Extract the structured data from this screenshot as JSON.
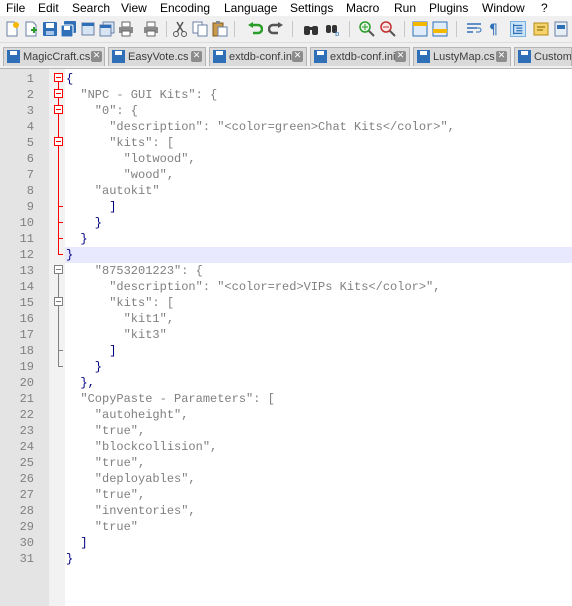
{
  "menu": [
    "File",
    "Edit",
    "Search",
    "View",
    "Encoding",
    "Language",
    "Settings",
    "Macro",
    "Run",
    "Plugins",
    "Window",
    "?"
  ],
  "toolbar": {
    "icons": [
      "new-file-icon",
      "open-file-icon",
      "save-icon",
      "save-all-icon",
      "close-icon",
      "close-all-icon",
      "print-icon",
      "cut-icon",
      "copy-icon",
      "paste-icon",
      "undo-icon",
      "redo-icon",
      "find-icon",
      "replace-icon",
      "zoom-in-icon",
      "zoom-out-icon",
      "sync-vertical-icon",
      "sync-horizontal-icon",
      "word-wrap-icon",
      "show-all-characters-icon",
      "indent-guide-icon",
      "user-defined-language-icon"
    ]
  },
  "tabs": [
    {
      "label": "MagicCraft.cs",
      "active": false
    },
    {
      "label": "EasyVote.cs",
      "active": false
    },
    {
      "label": "extdb-conf.ini",
      "active": false
    },
    {
      "label": "extdb-conf.ini",
      "active": false
    },
    {
      "label": "LustyMap.cs",
      "active": false
    },
    {
      "label": "CustomD",
      "active": false
    }
  ],
  "editor": {
    "current_line": 12,
    "lines": [
      {
        "n": "1",
        "text": "{"
      },
      {
        "n": "2",
        "text": "  \"NPC - GUI Kits\": {"
      },
      {
        "n": "3",
        "text": "    \"0\": {"
      },
      {
        "n": "4",
        "text": "      \"description\": \"<color=green>Chat Kits</color>\","
      },
      {
        "n": "5",
        "text": "      \"kits\": ["
      },
      {
        "n": "6",
        "text": "        \"lotwood\","
      },
      {
        "n": "7",
        "text": "        \"wood\","
      },
      {
        "n": "8",
        "text": "    \"autokit\""
      },
      {
        "n": "9",
        "text": "      ]"
      },
      {
        "n": "10",
        "text": "    }"
      },
      {
        "n": "11",
        "text": "  }"
      },
      {
        "n": "12",
        "text": "}"
      },
      {
        "n": "13",
        "text": "    \"8753201223\": {"
      },
      {
        "n": "14",
        "text": "      \"description\": \"<color=red>VIPs Kits</color>\","
      },
      {
        "n": "15",
        "text": "      \"kits\": ["
      },
      {
        "n": "16",
        "text": "        \"kit1\","
      },
      {
        "n": "17",
        "text": "        \"kit3\""
      },
      {
        "n": "18",
        "text": "      ]"
      },
      {
        "n": "19",
        "text": "    }"
      },
      {
        "n": "20",
        "text": "  },"
      },
      {
        "n": "21",
        "text": "  \"CopyPaste - Parameters\": ["
      },
      {
        "n": "22",
        "text": "    \"autoheight\","
      },
      {
        "n": "23",
        "text": "    \"true\","
      },
      {
        "n": "24",
        "text": "    \"blockcollision\","
      },
      {
        "n": "25",
        "text": "    \"true\","
      },
      {
        "n": "26",
        "text": "    \"deployables\","
      },
      {
        "n": "27",
        "text": "    \"true\","
      },
      {
        "n": "28",
        "text": "    \"inventories\","
      },
      {
        "n": "29",
        "text": "    \"true\""
      },
      {
        "n": "30",
        "text": "  ]"
      },
      {
        "n": "31",
        "text": "}"
      }
    ]
  },
  "colors": {
    "operator": "#000080",
    "string": "#808080",
    "key": "#800080",
    "fold_active": "#ff0000",
    "current_line": "#e8e8ff"
  }
}
